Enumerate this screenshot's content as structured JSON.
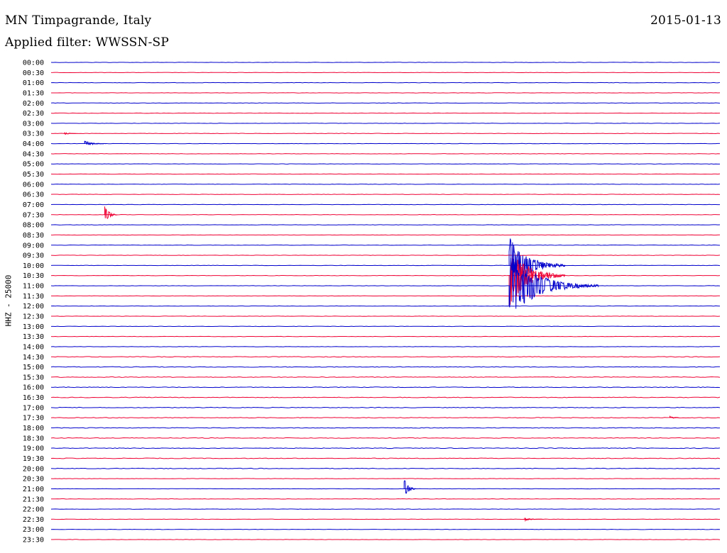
{
  "header": {
    "station": "MN Timpagrande, Italy",
    "date": "2015-01-13",
    "filter": "Applied filter: WWSSN-SP"
  },
  "axis": {
    "ylabel": "HHZ - 25000"
  },
  "colors": {
    "even_trace": "#0000cc",
    "odd_trace": "#ee0033",
    "text": "#000000"
  },
  "chart_data": {
    "type": "line",
    "description_kind": "helicorder",
    "rows": [
      "00:00",
      "00:30",
      "01:00",
      "01:30",
      "02:00",
      "02:30",
      "03:00",
      "03:30",
      "04:00",
      "04:30",
      "05:00",
      "05:30",
      "06:00",
      "06:30",
      "07:00",
      "07:30",
      "08:00",
      "08:30",
      "09:00",
      "09:30",
      "10:00",
      "10:30",
      "11:00",
      "11:30",
      "12:00",
      "12:30",
      "13:00",
      "13:30",
      "14:00",
      "14:30",
      "15:00",
      "15:30",
      "16:00",
      "16:30",
      "17:00",
      "17:30",
      "18:00",
      "18:30",
      "19:00",
      "19:30",
      "20:00",
      "20:30",
      "21:00",
      "21:30",
      "22:00",
      "22:30",
      "23:00",
      "23:30"
    ],
    "minutes_per_row": 30,
    "events": [
      {
        "row": 7,
        "minute": 0.6,
        "amplitude": 0.15,
        "duration_min": 0.5
      },
      {
        "row": 8,
        "minute": 1.5,
        "amplitude": 0.3,
        "duration_min": 1.0
      },
      {
        "row": 15,
        "minute": 2.4,
        "amplitude": 0.9,
        "duration_min": 0.6
      },
      {
        "row": 20,
        "minute": 20.5,
        "amplitude": 3.2,
        "duration_min": 2.5
      },
      {
        "row": 21,
        "minute": 20.5,
        "amplitude": 3.2,
        "duration_min": 2.5
      },
      {
        "row": 22,
        "minute": 20.5,
        "amplitude": 3.2,
        "duration_min": 4.0
      },
      {
        "row": 42,
        "minute": 15.8,
        "amplitude": 1.3,
        "duration_min": 0.5
      },
      {
        "row": 35,
        "minute": 27.7,
        "amplitude": 0.15,
        "duration_min": 0.4
      },
      {
        "row": 45,
        "minute": 21.2,
        "amplitude": 0.15,
        "duration_min": 0.8
      }
    ]
  }
}
